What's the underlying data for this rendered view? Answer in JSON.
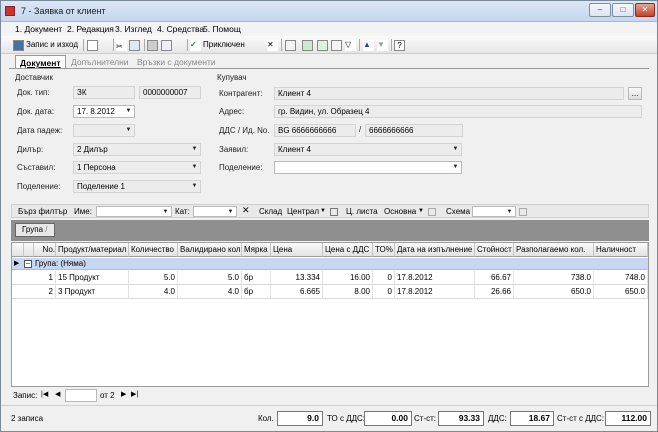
{
  "window": {
    "title": "7 - Заявка от клиент",
    "min": "–",
    "max": "□",
    "close": "✕"
  },
  "menu": [
    "1. Документ",
    "2. Редакция",
    "3. Изглед",
    "4. Средства",
    "5. Помощ"
  ],
  "toolbar": {
    "save_close": "Запис и изход",
    "apply": "Приключен"
  },
  "tabs": [
    "Документ",
    "Допълнителни",
    "Връзки с документи"
  ],
  "supplier": {
    "section": "Доставчик",
    "doc_type_label": "Док. тип:",
    "doc_type": "ЗК",
    "doc_number": "0000000007",
    "doc_date_label": "Док. дата:",
    "doc_date": "17.  8.2012",
    "due_date_label": "Дата падеж:",
    "due_date": "",
    "dealer_label": "Дилър:",
    "dealer": "2 Дилър",
    "author_label": "Съставил:",
    "author": "1 Персона",
    "division_label": "Поделение:",
    "division": "Поделение 1"
  },
  "buyer": {
    "section": "Купувач",
    "partner_label": "Контрагент:",
    "partner": "Клиент 4",
    "browse": "...",
    "address_label": "Адрес:",
    "address": "гр. Видин, ул. Образец 4",
    "vat_label": "ДДС / Ид. No.",
    "vat": "BG 6666666666",
    "slash": "/",
    "id_no": "6666666666",
    "requester_label": "Заявил:",
    "requester": "Клиент 4",
    "division_label": "Поделение:",
    "division": ""
  },
  "filter": {
    "quick": "Бърз филтър",
    "name": "Име:",
    "cat": "Кат:",
    "wh_label": "Склад",
    "wh": "Централ",
    "price_label": "Ц. листа",
    "price": "Основна",
    "scheme_label": "Схема"
  },
  "group": {
    "chip": "Група",
    "chip_suffix": "/",
    "row": "Група: (Няма)"
  },
  "grid": {
    "headers": [
      "No.",
      "Продукт/материал",
      "Количество",
      "Валидирано кол.",
      "Мярка",
      "Цена",
      "Цена с ДДС",
      "ТО%",
      "Дата на изпълнение",
      "Стойност",
      "Разполагаемо кол.",
      "Наличност"
    ],
    "rows": [
      [
        "1",
        "15 Продукт",
        "5.0",
        "5.0",
        "бр",
        "13.334",
        "16.00",
        "0",
        "17.8.2012",
        "66.67",
        "738.0",
        "748.0"
      ],
      [
        "2",
        "3 Продукт",
        "4.0",
        "4.0",
        "бр",
        "6.665",
        "8.00",
        "0",
        "17.8.2012",
        "26.66",
        "650.0",
        "650.0"
      ]
    ]
  },
  "nav": {
    "label": "Запис:",
    "of": "от 2",
    "current": ""
  },
  "status": {
    "count": "2 записа",
    "qty_label": "Кол.",
    "qty": "9.0",
    "to_label": "ТО с ДДС:",
    "to": "0.00",
    "cost_label": "Ст-ст:",
    "cost": "93.33",
    "vat_label": "ДДС:",
    "vat": "18.67",
    "total_label": "Ст-ст с ДДС:",
    "total": "112.00"
  }
}
